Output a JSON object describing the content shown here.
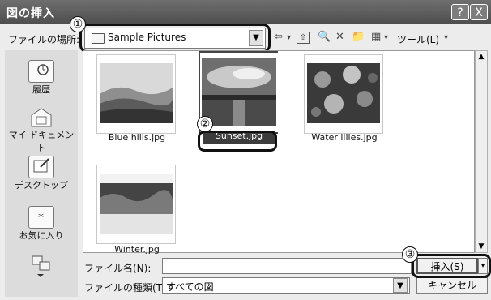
{
  "window": {
    "title": "図の挿入",
    "help_btn": "?",
    "close_btn": "X"
  },
  "toolbar": {
    "look_in_label": "ファイルの場所:",
    "look_in_value": "Sample Pictures",
    "back_icon": "⇦",
    "back_dd": "▾",
    "up_icon": "⇧",
    "search_icon": "🔍",
    "delete_icon": "✕",
    "new_folder_icon": "📁",
    "views_icon": "▦",
    "views_dd": "▾",
    "tools_label": "ツール(L)",
    "tools_dd": "▾"
  },
  "places": [
    {
      "label": "履歴",
      "icon": "history-icon"
    },
    {
      "label": "マイ ドキュメント",
      "icon": "my-documents-icon"
    },
    {
      "label": "デスクトップ",
      "icon": "desktop-icon"
    },
    {
      "label": "お気に入り",
      "icon": "favorites-icon"
    },
    {
      "label": "",
      "icon": "network-places-icon"
    }
  ],
  "files": [
    {
      "name": "Blue hills.jpg",
      "selected": false
    },
    {
      "name": "Sunset.jpg",
      "selected": true
    },
    {
      "name": "Water lilies.jpg",
      "selected": false
    },
    {
      "name": "Winter.jpg",
      "selected": false
    }
  ],
  "bottom": {
    "filename_label": "ファイル名(N):",
    "filename_value": "",
    "filetype_label": "ファイルの種類(T):",
    "filetype_value": "すべての図",
    "insert_button": "挿入(S)",
    "insert_dd": "▾",
    "cancel_button": "キャンセル"
  },
  "callouts": [
    "①",
    "②",
    "③"
  ],
  "colors": {
    "titlebar": "#5a5a5a",
    "selection": "#3c3c3c",
    "window_bg": "#ececec",
    "places_bg": "#dcdcdc"
  }
}
